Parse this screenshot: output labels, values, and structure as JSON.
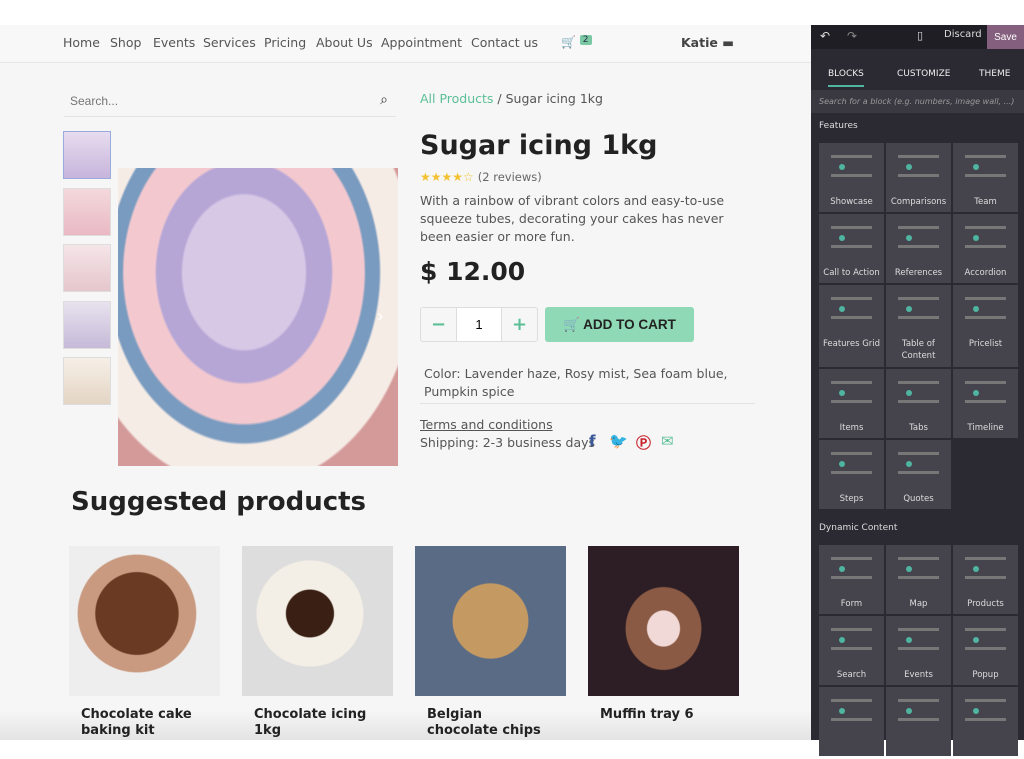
{
  "nav": {
    "items": [
      "Home",
      "Shop",
      "Events",
      "Services",
      "Pricing",
      "About Us",
      "Appointment",
      "Contact us"
    ],
    "cart_count": "2",
    "user": "Katie ▬"
  },
  "search": {
    "placeholder": "Search..."
  },
  "breadcrumb": {
    "parent": "All Products",
    "current": "Sugar icing 1kg"
  },
  "product": {
    "title": "Sugar icing 1kg",
    "rating": 4.5,
    "stars": "★★★★☆",
    "reviews": "(2 reviews)",
    "description": "With a rainbow of vibrant colors and easy-to-use squeeze tubes, decorating your cakes has never been easier or more fun.",
    "price": "$ 12.00",
    "quantity": "1",
    "add_to_cart": "ADD TO CART",
    "color": "Color: Lavender haze, Rosy mist, Sea foam blue, Pumpkin spice",
    "terms": "Terms and conditions",
    "shipping": "Shipping: 2-3 business days"
  },
  "suggested": {
    "title": "Suggested products",
    "items": [
      "Chocolate cake baking kit",
      "Chocolate icing 1kg",
      "Belgian chocolate chips",
      "Muffin tray 6"
    ]
  },
  "editor": {
    "discard": "Discard",
    "save": "Save",
    "tabs": [
      "BLOCKS",
      "CUSTOMIZE",
      "THEME"
    ],
    "search_placeholder": "Search for a block (e.g. numbers, image wall, ...)",
    "features_title": "Features",
    "features": [
      "Showcase",
      "Comparisons",
      "Team",
      "Call to Action",
      "References",
      "Accordion",
      "Features Grid",
      "Table of Content",
      "Pricelist",
      "Items",
      "Tabs",
      "Timeline",
      "Steps",
      "Quotes"
    ],
    "dynamic_title": "Dynamic Content",
    "dynamic": [
      "Form",
      "Map",
      "Products",
      "Search",
      "Events",
      "Popup",
      "",
      "",
      ""
    ]
  },
  "colors": {
    "accent": "#5bbf97",
    "save": "#845f7e",
    "panel": "#2b2a33"
  }
}
